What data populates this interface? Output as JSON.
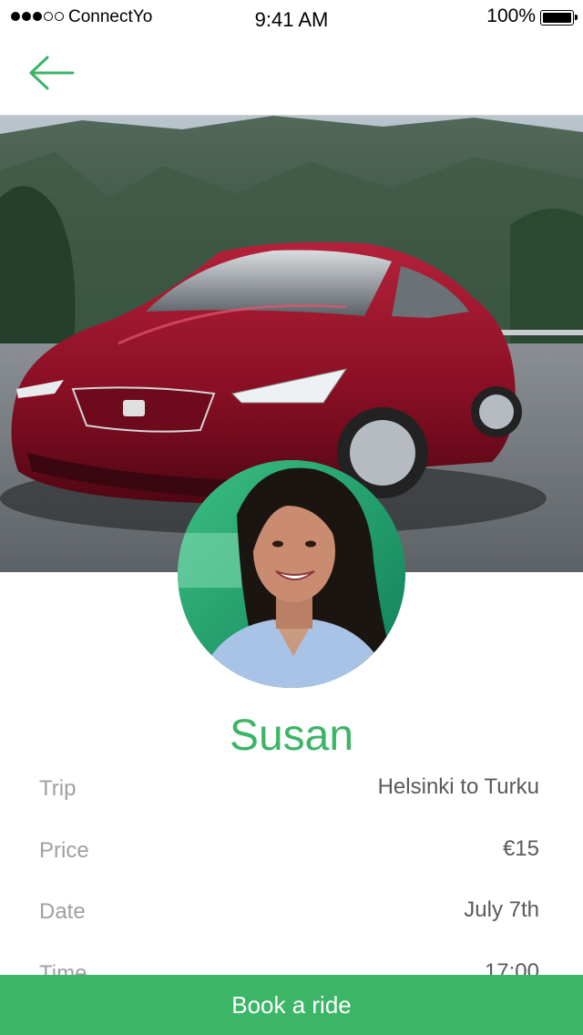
{
  "status_bar": {
    "carrier": "ConnectYo",
    "time": "9:41 AM",
    "battery": "100%",
    "signal_bars_filled": 3,
    "signal_bars_total": 5
  },
  "nav": {
    "back_icon": "arrow-left-icon"
  },
  "hero": {
    "image": "red-sports-car-photo"
  },
  "driver": {
    "name": "Susan",
    "avatar": "driver-portrait-photo"
  },
  "details": [
    {
      "label": "Trip",
      "value": "Helsinki to Turku"
    },
    {
      "label": "Price",
      "value": "€15"
    },
    {
      "label": "Date",
      "value": "July 7th"
    },
    {
      "label": "Time",
      "value": "17:00"
    }
  ],
  "book_button": {
    "label": "Book a ride"
  },
  "colors": {
    "accent": "#3cb567",
    "label_gray": "#a0a0a0",
    "value_gray": "#5a5a5a"
  }
}
